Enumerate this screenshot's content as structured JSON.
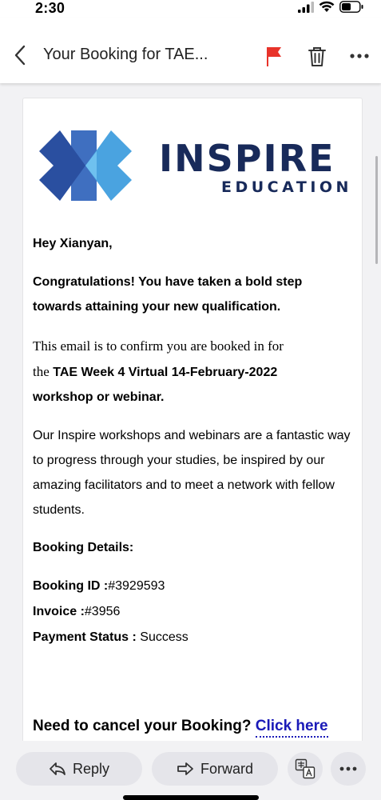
{
  "status_bar": {
    "time": "2:30"
  },
  "nav": {
    "title": "Your Booking for TAE..."
  },
  "email": {
    "brand": {
      "name": "INSPIRE",
      "sub": "EDUCATION"
    },
    "greeting": "Hey Xianyan,",
    "congrats": "Congratulations! You have taken a bold step towards attaining your new qualification.",
    "confirm_intro": "This email is to confirm you are booked in for",
    "confirm_the": "the",
    "event_name": "TAE Week 4 Virtual 14-February-2022",
    "event_suffix": "workshop or webinar.",
    "paragraph": "Our Inspire workshops and webinars are a fantastic way to progress through your studies, be inspired by our amazing facilitators and to meet a network with fellow students.",
    "details_heading": "Booking Details:",
    "booking_id_label": "Booking ID :",
    "booking_id_value": "#3929593",
    "invoice_label": "Invoice :",
    "invoice_value": "#3956",
    "payment_label": "Payment Status :",
    "payment_value": "Success",
    "cancel_prompt": "Need to cancel your Booking?",
    "cancel_link": "Click here"
  },
  "toolbar": {
    "reply_label": "Reply",
    "forward_label": "Forward"
  },
  "colors": {
    "flag": "#e8332a",
    "brand_navy": "#182a5a",
    "link": "#1a1ab8",
    "logo_dark": "#2a4fa0",
    "logo_light": "#4aa3e0"
  }
}
